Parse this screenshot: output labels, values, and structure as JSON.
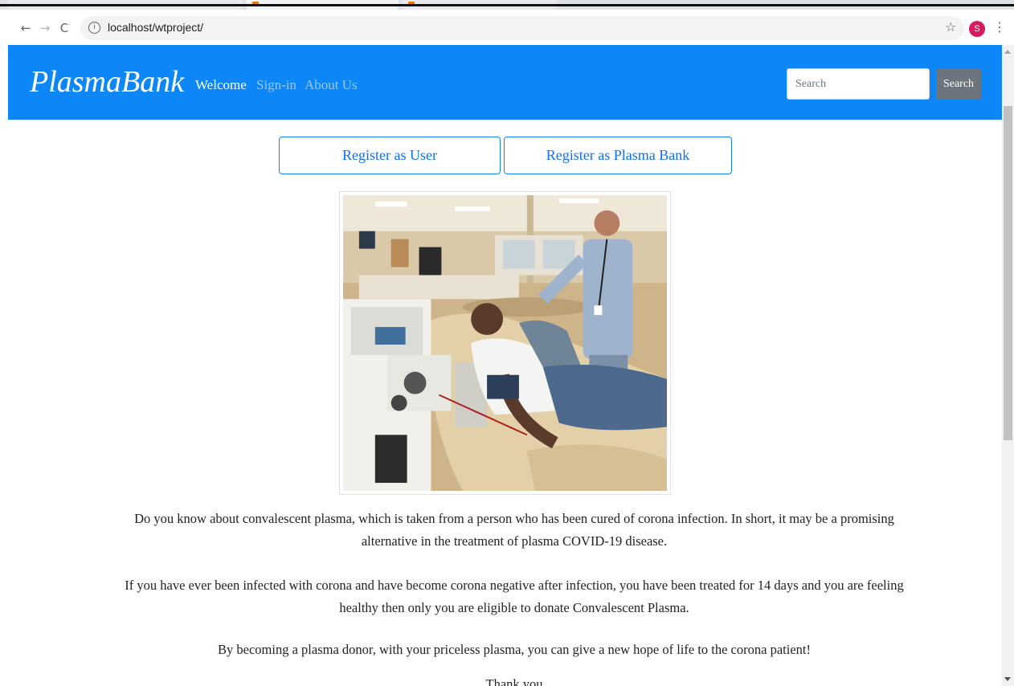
{
  "browser": {
    "url": "localhost/wtproject/",
    "avatar_letter": "S",
    "back_icon": "arrow-left-icon",
    "forward_icon": "arrow-right-icon",
    "reload_icon": "reload-icon",
    "bookmark_icon": "star-icon",
    "menu_icon": "kebab-icon"
  },
  "navbar": {
    "brand": "PlasmaBank",
    "links": [
      {
        "label": "Welcome"
      },
      {
        "label": "Sign-in"
      },
      {
        "label": "About Us"
      }
    ],
    "search_placeholder": "Search",
    "search_button": "Search",
    "color": "#0d87f7"
  },
  "register": {
    "user": "Register as User",
    "bank": "Register as Plasma Bank"
  },
  "content": {
    "para1": "Do you know about convalescent plasma, which is taken from a person who has been cured of corona infection. In short, it may be a promising alternative in the treatment of plasma COVID-19 disease.",
    "para2": "If you have ever been infected with corona and have become corona negative after infection, you have been treated for 14 days and you are feeling healthy then only you are eligible to donate Convalescent Plasma.",
    "para3": "By becoming a plasma donor, with your priceless plasma, you can give a new hope of life to the corona patient!",
    "para4": "Thank you"
  }
}
